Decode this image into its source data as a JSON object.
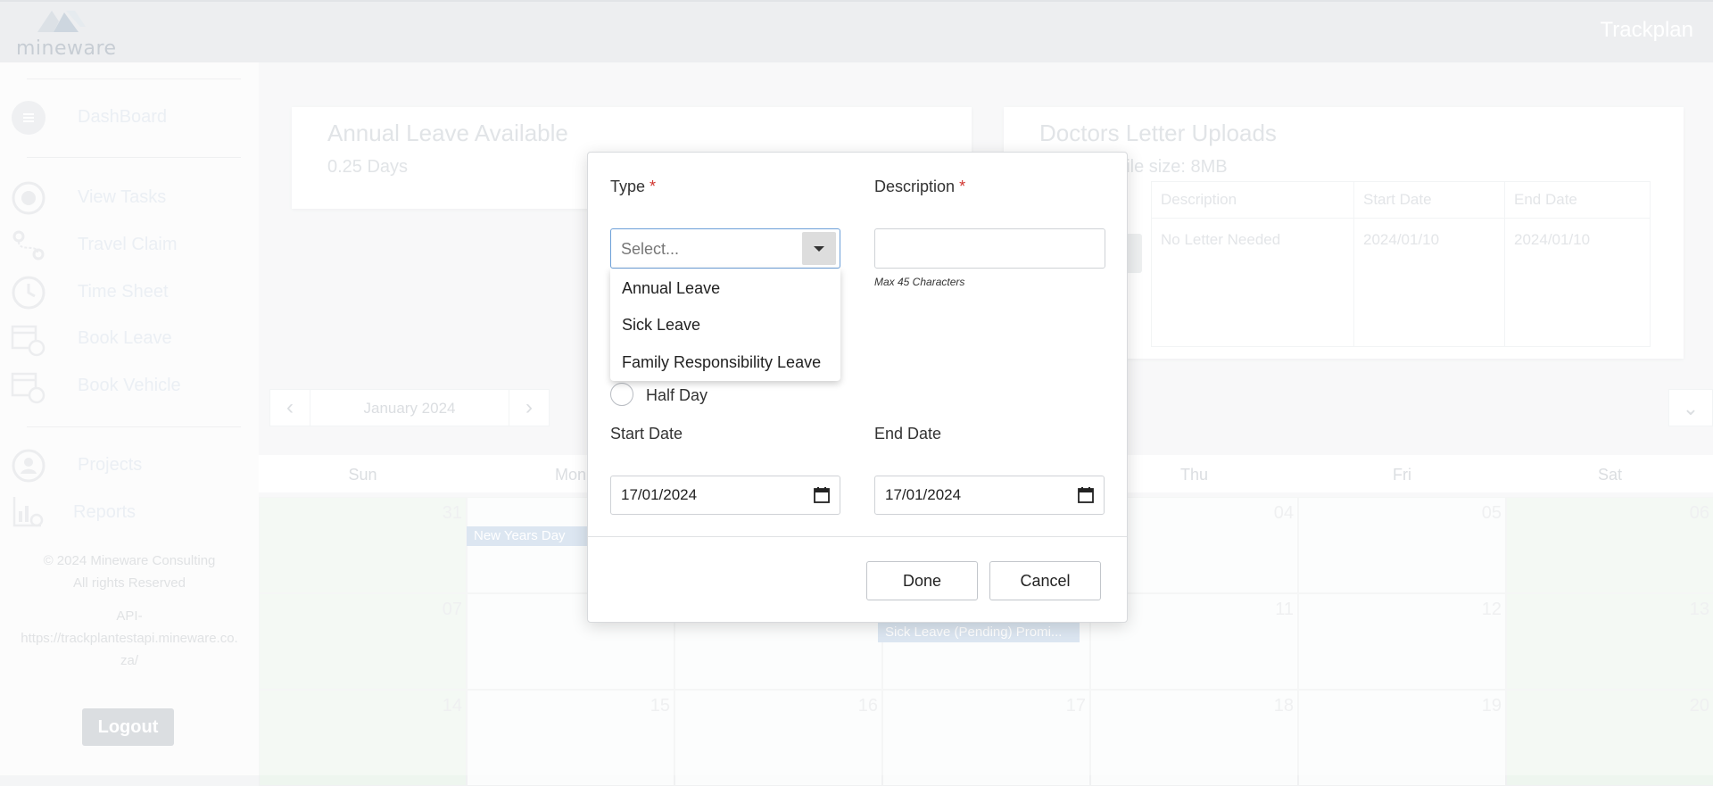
{
  "app": {
    "brand": "mineware",
    "title": "Trackplan"
  },
  "sidebar": {
    "items": [
      {
        "label": "DashBoard",
        "icon": "menu-icon"
      },
      {
        "label": "View Tasks",
        "icon": "target-icon"
      },
      {
        "label": "Travel Claim",
        "icon": "route-pin-icon"
      },
      {
        "label": "Time Sheet",
        "icon": "clock-icon"
      },
      {
        "label": "Book Leave",
        "icon": "calendar-clock-icon"
      },
      {
        "label": "Book Vehicle",
        "icon": "calendar-clock-icon"
      },
      {
        "label": "Projects",
        "icon": "users-circle-icon"
      },
      {
        "label": "Reports",
        "icon": "report-chart-icon"
      }
    ],
    "copyright": "© 2024 Mineware Consulting",
    "rights": "All rights Reserved",
    "api_label": "API-",
    "api_url_1": "https://trackplantestapi.mineware.co.",
    "api_url_2": "za/",
    "logout_label": "Logout"
  },
  "cards": {
    "annual_leave": {
      "title": "Annual Leave Available",
      "value": "0.25 Days"
    },
    "doctors_letter": {
      "title": "Doctors Letter Uploads",
      "subtitle": "n file size: 8MB",
      "columns": [
        "Description",
        "Start Date",
        "End Date"
      ],
      "rows": [
        [
          "No Letter Needed",
          "2024/01/10",
          "2024/01/10"
        ]
      ]
    }
  },
  "calendar": {
    "month_label": "January 2024",
    "day_names": [
      "Sun",
      "Mon",
      "",
      "",
      "Thu",
      "Fri",
      "Sat"
    ],
    "weeks": [
      [
        "31",
        "",
        "",
        "",
        "04",
        "05",
        "06"
      ],
      [
        "07",
        "",
        "",
        "",
        "11",
        "12",
        "13"
      ],
      [
        "14",
        "15",
        "16",
        "17",
        "18",
        "19",
        "20"
      ]
    ],
    "events": [
      {
        "label": "New Years Day"
      },
      {
        "label": "Sick Leave (Pending) Promi..."
      }
    ]
  },
  "modal": {
    "type_label": "Type",
    "description_label": "Description",
    "required_mark": "*",
    "type_placeholder": "Select...",
    "type_options": [
      "Annual Leave",
      "Sick Leave",
      "Family Responsibility Leave"
    ],
    "description_value": "",
    "description_hint": "Max 45 Characters",
    "half_day_label": "Half Day",
    "half_day_checked": false,
    "start_date_label": "Start Date",
    "end_date_label": "End Date",
    "start_date_value": "17/01/2024",
    "end_date_value": "17/01/2024",
    "done_label": "Done",
    "cancel_label": "Cancel"
  },
  "colors": {
    "focus_border": "#6c9fd8",
    "required": "#d0352f",
    "weekend_bg": "#eef6ef",
    "event_bg": "#c9d9ea"
  }
}
